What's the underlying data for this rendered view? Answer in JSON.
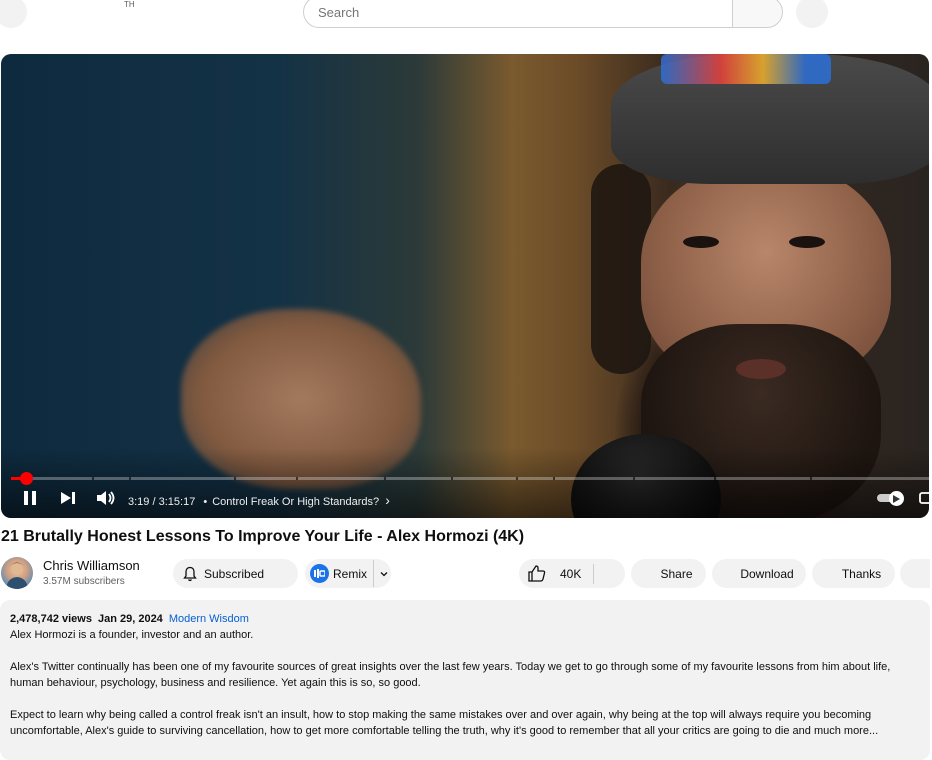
{
  "header": {
    "region_code": "TH",
    "search": {
      "placeholder": "Search",
      "value": ""
    }
  },
  "player": {
    "progress": {
      "current_fraction": 0.0168,
      "chapter_breaks": [
        0.088,
        0.129,
        0.243,
        0.311,
        0.406,
        0.479,
        0.55,
        0.59,
        0.678,
        0.766,
        0.87
      ]
    },
    "time_current": "3:19",
    "time_separator": "/",
    "time_total": "3:15:17",
    "chapter_bullet": "•",
    "chapter_title": "Control Freak Or High Standards?",
    "chapter_arrow": "›",
    "state": "playing",
    "autoplay": true
  },
  "video": {
    "title": "21 Brutally Honest Lessons To Improve Your Life - Alex Hormozi (4K)"
  },
  "channel": {
    "name": "Chris Williamson",
    "subscribers": "3.57M subscribers",
    "subscribe_label": "Subscribed"
  },
  "actions": {
    "remix_label": "Remix",
    "like_count": "40K",
    "share_label": "Share",
    "download_label": "Download",
    "thanks_label": "Thanks"
  },
  "description": {
    "views": "2,478,742 views",
    "date": "Jan 29, 2024",
    "tag": "Modern Wisdom",
    "line1": "Alex Hormozi is a founder, investor and an author.",
    "para2": "Alex's Twitter continually has been one of my favourite sources of great insights over the last few years. Today we get to go through some of my favourite lessons from him about life, human behaviour, psychology, business and resilience. Yet again this is so, so good.",
    "para3": "Expect to learn why being called a control freak isn't an insult, how to stop making the same mistakes over and over again, why being at the top will always require you becoming uncomfortable, Alex's guide to surviving cancellation, how to get more comfortable telling the truth, why it's good to remember that all your critics are going to die and much more..."
  },
  "colors": {
    "accent_red": "#ff0000",
    "link_blue": "#065fd4",
    "pill_bg": "#f2f2f2",
    "remix_badge": "#1a73e8"
  }
}
